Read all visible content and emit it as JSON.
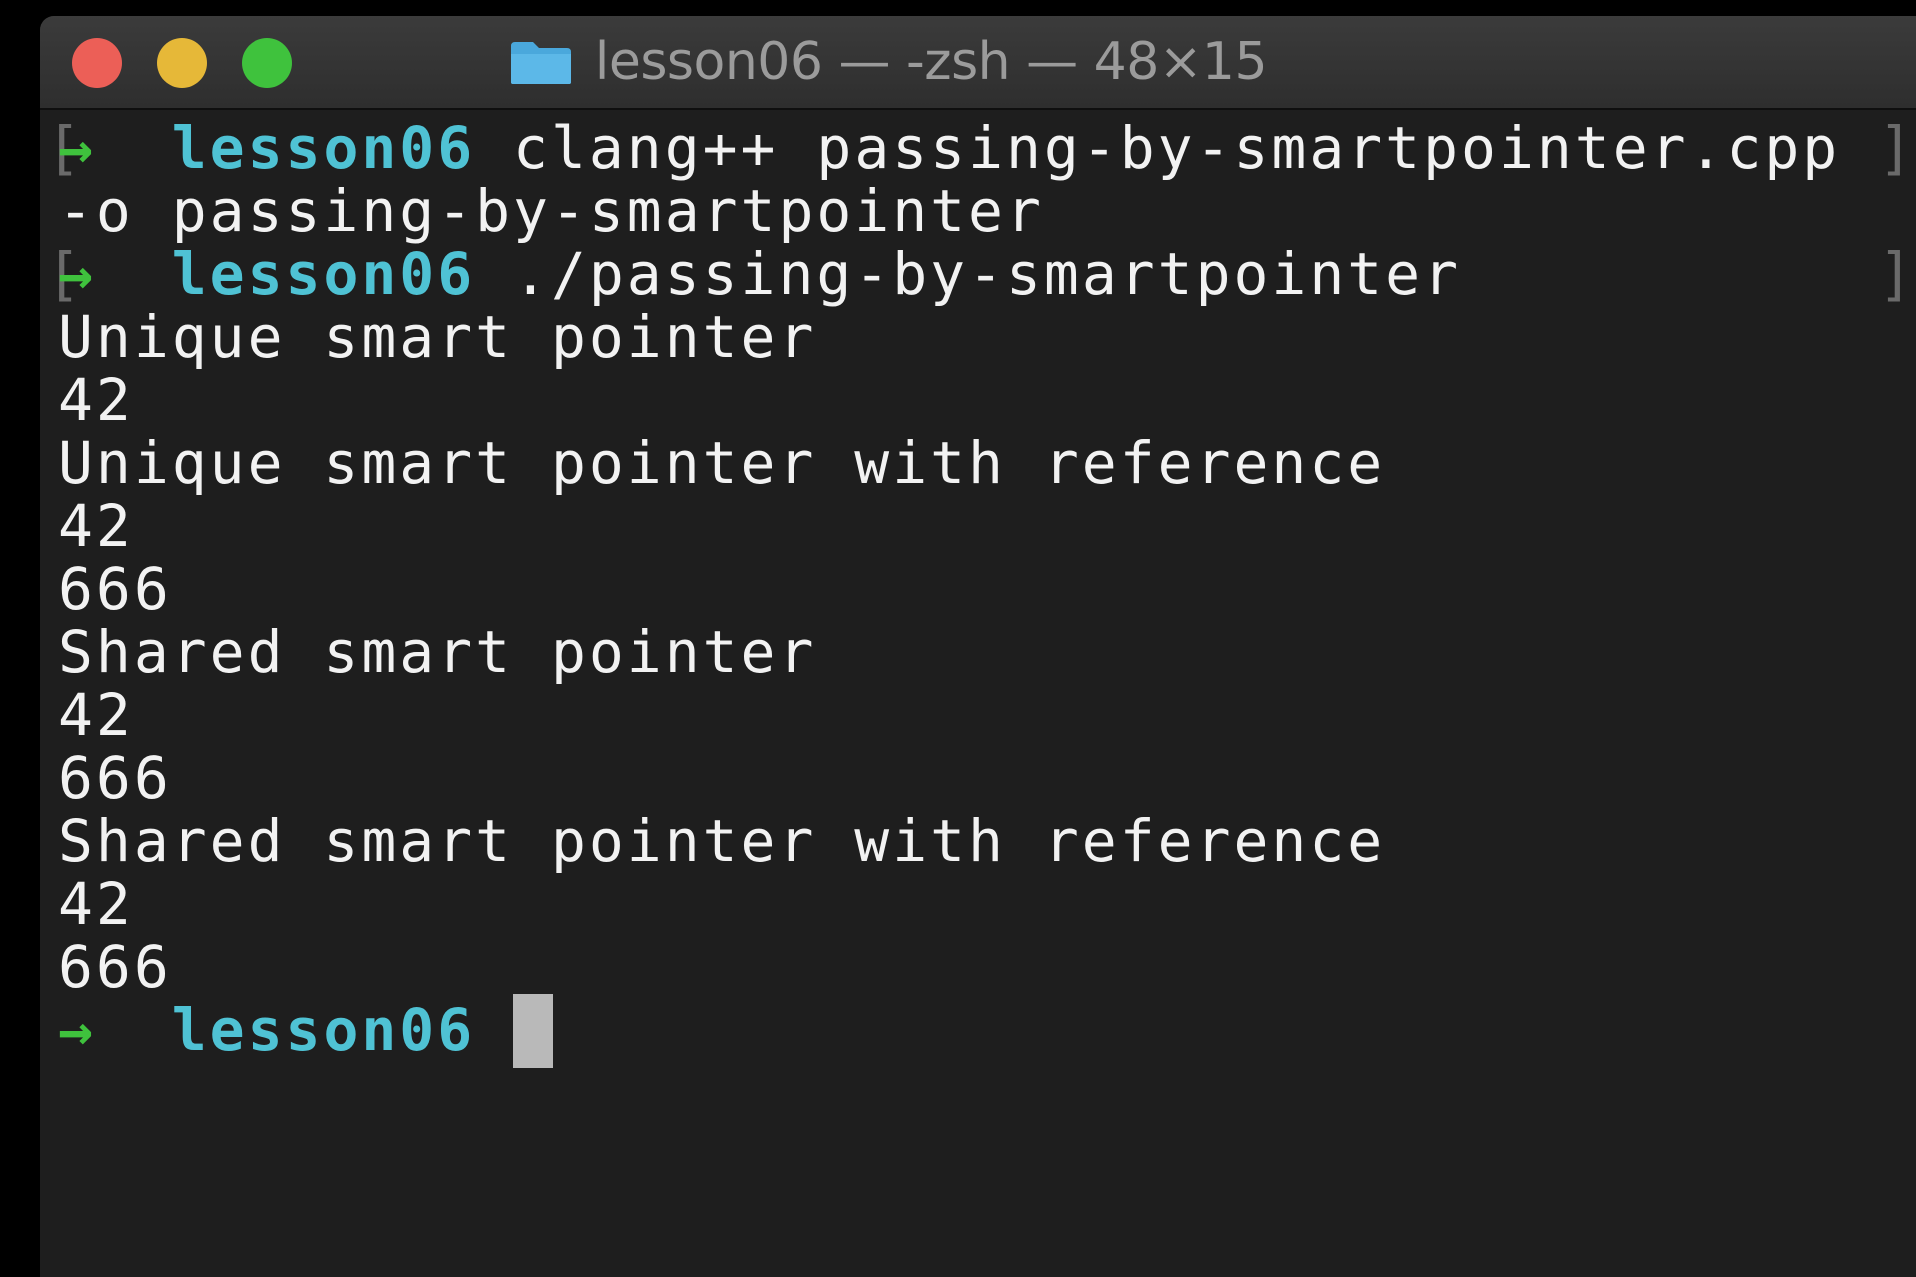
{
  "window": {
    "title": "lesson06 — -zsh — 48×15"
  },
  "icons": {
    "folder": "folder-icon",
    "prompt_arrow": "→"
  },
  "colors": {
    "background": "#1e1e1e",
    "text": "#f2f2f2",
    "prompt_arrow": "#3fc23d",
    "directory": "#4fc2d4",
    "close": "#ec5f57",
    "minimize": "#e6b838",
    "zoom": "#3fc23d"
  },
  "terminal": {
    "prompt_dir": "lesson06",
    "command1_part1": "clang++ passing-by-smartpointer.cpp",
    "command1_part2": "-o passing-by-smartpointer",
    "command2": "./passing-by-smartpointer",
    "output": [
      "Unique smart pointer",
      "42",
      "Unique smart pointer with reference",
      "42",
      "666",
      "Shared smart pointer",
      "42",
      "666",
      "Shared smart pointer with reference",
      "42",
      "666"
    ]
  }
}
